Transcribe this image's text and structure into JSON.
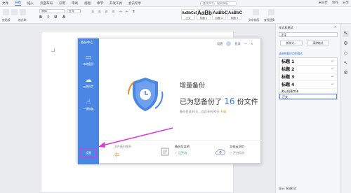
{
  "menubar": {
    "items": [
      "文件",
      "开始",
      "插入",
      "页面布局",
      "引用",
      "审阅",
      "视图",
      "章节",
      "开发工具",
      "会员专享"
    ],
    "active_index": 1,
    "search_placeholder": "查找命令、搜索模板",
    "right": [
      "未同步",
      "协作",
      "分享"
    ]
  },
  "ribbon": {
    "font_name": "宋体",
    "font_size": "五号",
    "styles": [
      {
        "preview": "AaBbCcDd",
        "label": "正文"
      },
      {
        "preview": "AaBb",
        "label": "标题 1"
      },
      {
        "preview": "AaBbC",
        "label": "标题 2"
      },
      {
        "preview": "AaBbC",
        "label": "标题 3"
      }
    ],
    "labels": [
      "剪贴板",
      "格式刷",
      "文字排版",
      "查找替换"
    ]
  },
  "sidepane": {
    "title": "样式和格式",
    "current": "正文",
    "btn_new": "新样式...",
    "btn_clear": "清除格式",
    "sub": "请选择要应用的格式",
    "items": [
      "标题  1",
      "标题  2",
      "标题  3",
      "标题  4"
    ],
    "plain_item": "默认段落字体",
    "selected_item": "正文",
    "footer": "显示: 有效样式"
  },
  "dialog": {
    "brand": "备份中心",
    "top_links": [
      "设置",
      "登录"
    ],
    "sidebar": [
      {
        "label": "本地备份",
        "icon": "folder-icon"
      },
      {
        "label": "云端同步",
        "icon": "cloud-icon"
      },
      {
        "label": "一键恢复",
        "icon": "hand-icon"
      }
    ],
    "settings": "设置",
    "hero_title": "增量备份",
    "hero_prefix": "已为您备份了",
    "hero_count": "16",
    "hero_suffix": "份文件",
    "hero_sub": "备份目录30天，会员享有90天",
    "hero_sub_link": "升级",
    "bottom": {
      "freq_caption": "文件备份频率",
      "freq_value": "中",
      "local_title": "备份至本地",
      "local_status": "✓ 已开启",
      "cloud_title": "文档云同步",
      "cloud_status": "开启同步"
    }
  },
  "colors": {
    "accent": "#4a86e3",
    "highlight": "#d93ad8",
    "orange": "#f08a24",
    "green": "#2eae5a"
  }
}
